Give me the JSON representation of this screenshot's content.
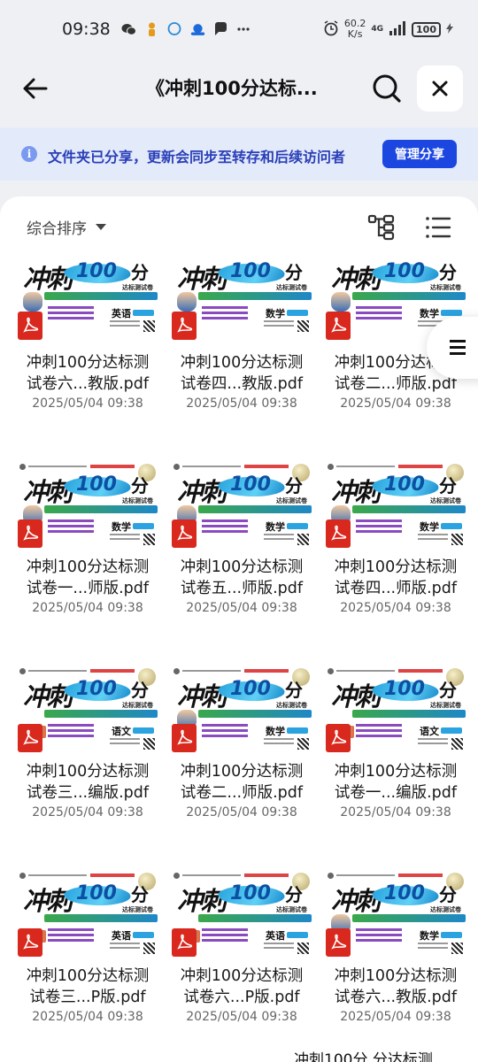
{
  "status_bar": {
    "time": "09:38",
    "speed_value": "60.2",
    "speed_unit": "K/s",
    "network": "4G",
    "battery": "100"
  },
  "header": {
    "title": "《冲刺100分达标...",
    "back_icon": "arrow-left-icon",
    "search_icon": "search-icon",
    "close_icon": "close-icon"
  },
  "banner": {
    "text": "文件夹已分享，更新会同步至转存和后续访问者",
    "button_label": "管理分享"
  },
  "toolbar": {
    "sort_label": "综合排序"
  },
  "files": [
    {
      "name": "冲刺100分达标测\n试卷六...教版.pdf",
      "date": "2025/05/04 09:38",
      "subject": "英语"
    },
    {
      "name": "冲刺100分达标测\n试卷四...教版.pdf",
      "date": "2025/05/04 09:38",
      "subject": "数学"
    },
    {
      "name": "冲刺100分达标测\n试卷二...师版.pdf",
      "date": "2025/05/04 09:38",
      "subject": "数学"
    },
    {
      "name": "冲刺100分达标测\n试卷一...师版.pdf",
      "date": "2025/05/04 09:38",
      "subject": "数学"
    },
    {
      "name": "冲刺100分达标测\n试卷五...师版.pdf",
      "date": "2025/05/04 09:38",
      "subject": "数学"
    },
    {
      "name": "冲刺100分达标测\n试卷四...师版.pdf",
      "date": "2025/05/04 09:38",
      "subject": "数学"
    },
    {
      "name": "冲刺100分达标测\n试卷三...编版.pdf",
      "date": "2025/05/04 09:38",
      "subject": "语文"
    },
    {
      "name": "冲刺100分达标测\n试卷二...师版.pdf",
      "date": "2025/05/04 09:38",
      "subject": "数学"
    },
    {
      "name": "冲刺100分达标测\n试卷一...编版.pdf",
      "date": "2025/05/04 09:38",
      "subject": "语文"
    },
    {
      "name": "冲刺100分达标测\n试卷三...P版.pdf",
      "date": "2025/05/04 09:38",
      "subject": "英语"
    },
    {
      "name": "冲刺100分达标测\n试卷六...P版.pdf",
      "date": "2025/05/04 09:38",
      "subject": "英语"
    },
    {
      "name": "冲刺100分达标测\n试卷六...教版.pdf",
      "date": "2025/05/04 09:38",
      "subject": "数学"
    }
  ],
  "thumb_text": {
    "title_big": "冲刺",
    "hundred": "100",
    "fen": "分",
    "subtitle": "达标测试卷"
  },
  "peek_text": "冲刺100分   分达标测",
  "colors": {
    "accent": "#1b46e0",
    "banner_bg": "#e3eafa",
    "pdf_red": "#d9281d"
  }
}
